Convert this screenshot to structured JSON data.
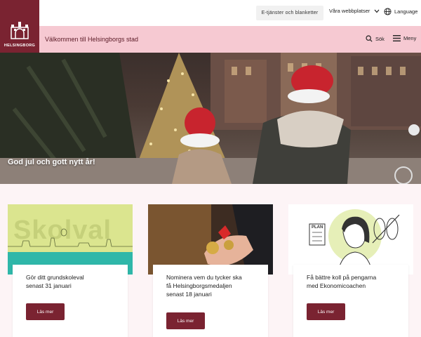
{
  "logo": {
    "text": "HELSINGBORG"
  },
  "topbar": {
    "eservices_label": "E-tjänster och blanketter",
    "webplaces_label": "Våra webbplatser",
    "language_label": "Language"
  },
  "header": {
    "welcome": "Välkommen till Helsingborgs stad",
    "search_label": "Sök",
    "menu_label": "Meny"
  },
  "hero": {
    "title": "God jul och gott nytt år!"
  },
  "cards": [
    {
      "title_line1": "Gör ditt grundskoleval",
      "title_line2": "senast 31 januari",
      "image_word": "Skolval",
      "button": "Läs mer"
    },
    {
      "title_line1": "Nominera vem du tycker ska",
      "title_line2": "få Helsingborgsmedaljen",
      "title_line3": "senast 18 januari",
      "button": "Läs mer"
    },
    {
      "title_line1": "Få bättre koll på pengarna",
      "title_line2": "med Ekonomicoachen",
      "image_word": "PLAN",
      "button": "Läs mer"
    }
  ],
  "colors": {
    "brand": "#7a2331",
    "header_pink": "#f6c9d2",
    "content_bg": "#fdf4f6"
  }
}
